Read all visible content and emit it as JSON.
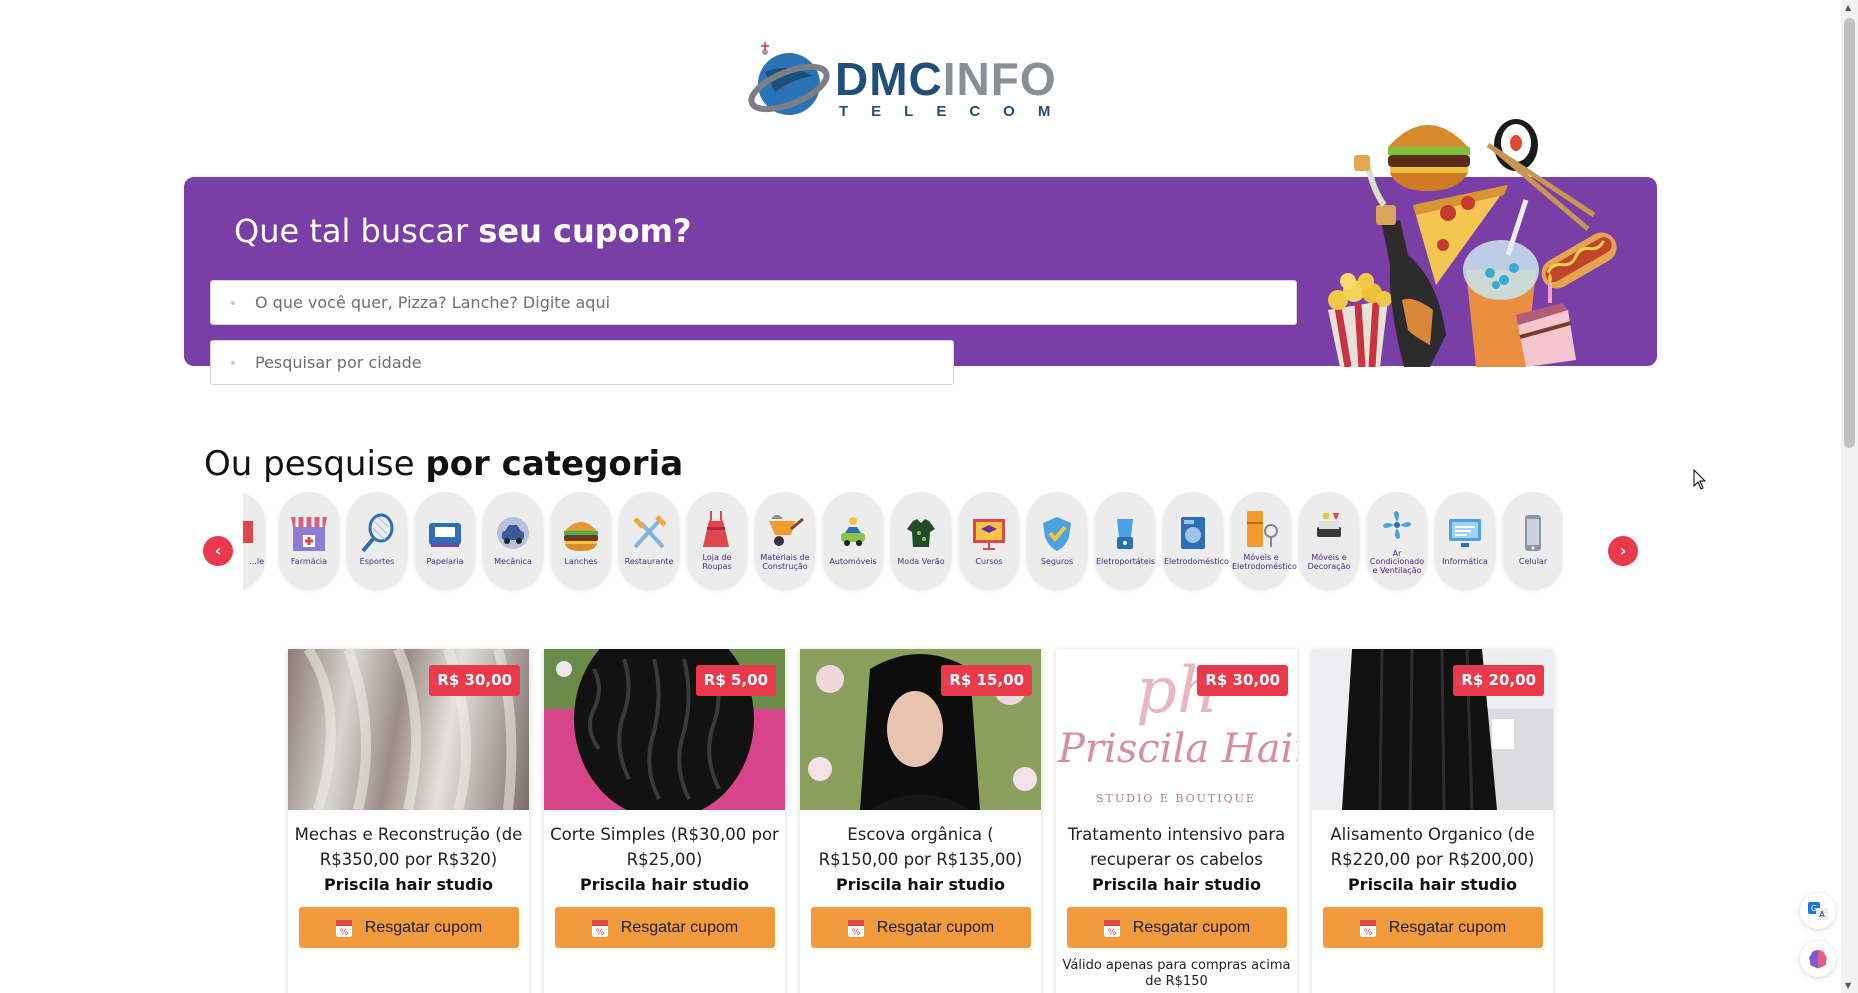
{
  "brand": {
    "logo_word_a": "DMC",
    "logo_word_b": "INFO",
    "logo_sub": "TELECOM",
    "primary_color": "#7a3fa6",
    "accent_color": "#e83a4b",
    "button_color": "#f19a3e"
  },
  "hero": {
    "title_plain": "Que tal buscar ",
    "title_bold": "seu cupom?",
    "search_placeholder": "O que você quer, Pizza? Lanche? Digite aqui",
    "city_placeholder": "Pesquisar por cidade"
  },
  "categories": {
    "title_plain": "Ou pesquise ",
    "title_bold": "por categoria",
    "prev_label": "‹",
    "next_label": "›",
    "items": [
      {
        "label": "...le",
        "icon": "partial-icon"
      },
      {
        "label": "Farmácia",
        "icon": "pharmacy-icon"
      },
      {
        "label": "Esportes",
        "icon": "tennis-racket-icon"
      },
      {
        "label": "Papelaria",
        "icon": "stationery-icon"
      },
      {
        "label": "Mecânica",
        "icon": "mechanic-car-icon"
      },
      {
        "label": "Lanches",
        "icon": "burger-icon"
      },
      {
        "label": "Restaurante",
        "icon": "cutlery-icon"
      },
      {
        "label": "Loja de Roupas",
        "icon": "dress-icon"
      },
      {
        "label": "Materiais de Construção",
        "icon": "wheelbarrow-icon"
      },
      {
        "label": "Automóveis",
        "icon": "car-icon"
      },
      {
        "label": "Moda Verão",
        "icon": "shirt-icon"
      },
      {
        "label": "Cursos",
        "icon": "graduation-board-icon"
      },
      {
        "label": "Seguros",
        "icon": "shield-check-icon"
      },
      {
        "label": "Eletroportáteis",
        "icon": "blender-icon"
      },
      {
        "label": "Eletrodoméstico",
        "icon": "washing-machine-icon"
      },
      {
        "label": "Móveis e Eletrodoméstico",
        "icon": "fridge-icon"
      },
      {
        "label": "Móveis e Decoração",
        "icon": "sofa-icon"
      },
      {
        "label": "Ar Condicionado e Ventilação",
        "icon": "fan-icon"
      },
      {
        "label": "Informática",
        "icon": "monitor-icon"
      },
      {
        "label": "Celular",
        "icon": "phone-icon"
      }
    ]
  },
  "coupons": [
    {
      "price": "R$ 30,00",
      "title": "Mechas e Reconstrução (de R$350,00 por R$320)",
      "store": "Priscila hair studio",
      "button": "Resgatar cupom",
      "note": ""
    },
    {
      "price": "R$ 5,00",
      "title": "Corte Simples (R$30,00 por R$25,00)",
      "store": "Priscila hair studio",
      "button": "Resgatar cupom",
      "note": ""
    },
    {
      "price": "R$ 15,00",
      "title": "Escova orgânica ( R$150,00 por R$135,00)",
      "store": "Priscila hair studio",
      "button": "Resgatar cupom",
      "note": ""
    },
    {
      "price": "R$ 30,00",
      "title": "Tratamento intensivo para recuperar os cabelos",
      "store": "Priscila hair studio",
      "button": "Resgatar cupom",
      "note": "Válido apenas para compras acima de R$150",
      "image_text_a": "ph",
      "image_text_b": "Priscila Hair",
      "image_text_c": "STUDIO E BOUTIQUE"
    },
    {
      "price": "R$ 20,00",
      "title": "Alisamento Organico (de R$220,00 por R$200,00)",
      "store": "Priscila hair studio",
      "button": "Resgatar cupom",
      "note": ""
    }
  ]
}
